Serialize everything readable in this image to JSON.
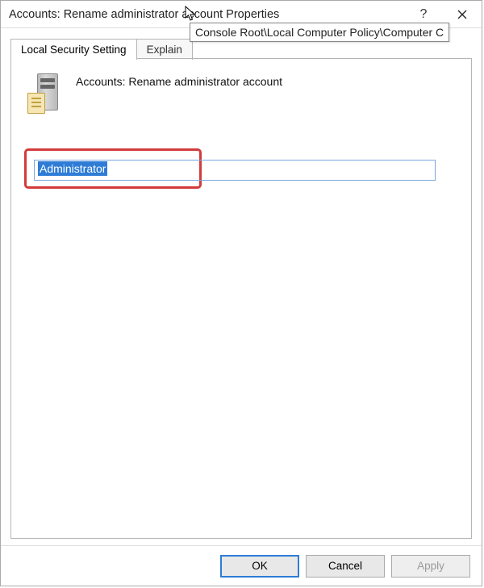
{
  "titlebar": {
    "title": "Accounts: Rename administrator account Properties",
    "help_symbol": "?",
    "close_symbol": "✕"
  },
  "tooltip": {
    "text": "Console Root\\Local Computer Policy\\Computer C"
  },
  "tabs": {
    "tab1": "Local Security Setting",
    "tab2": "Explain"
  },
  "policy": {
    "heading": "Accounts: Rename administrator account"
  },
  "input": {
    "value": "Administrator"
  },
  "buttons": {
    "ok": "OK",
    "cancel": "Cancel",
    "apply": "Apply"
  }
}
